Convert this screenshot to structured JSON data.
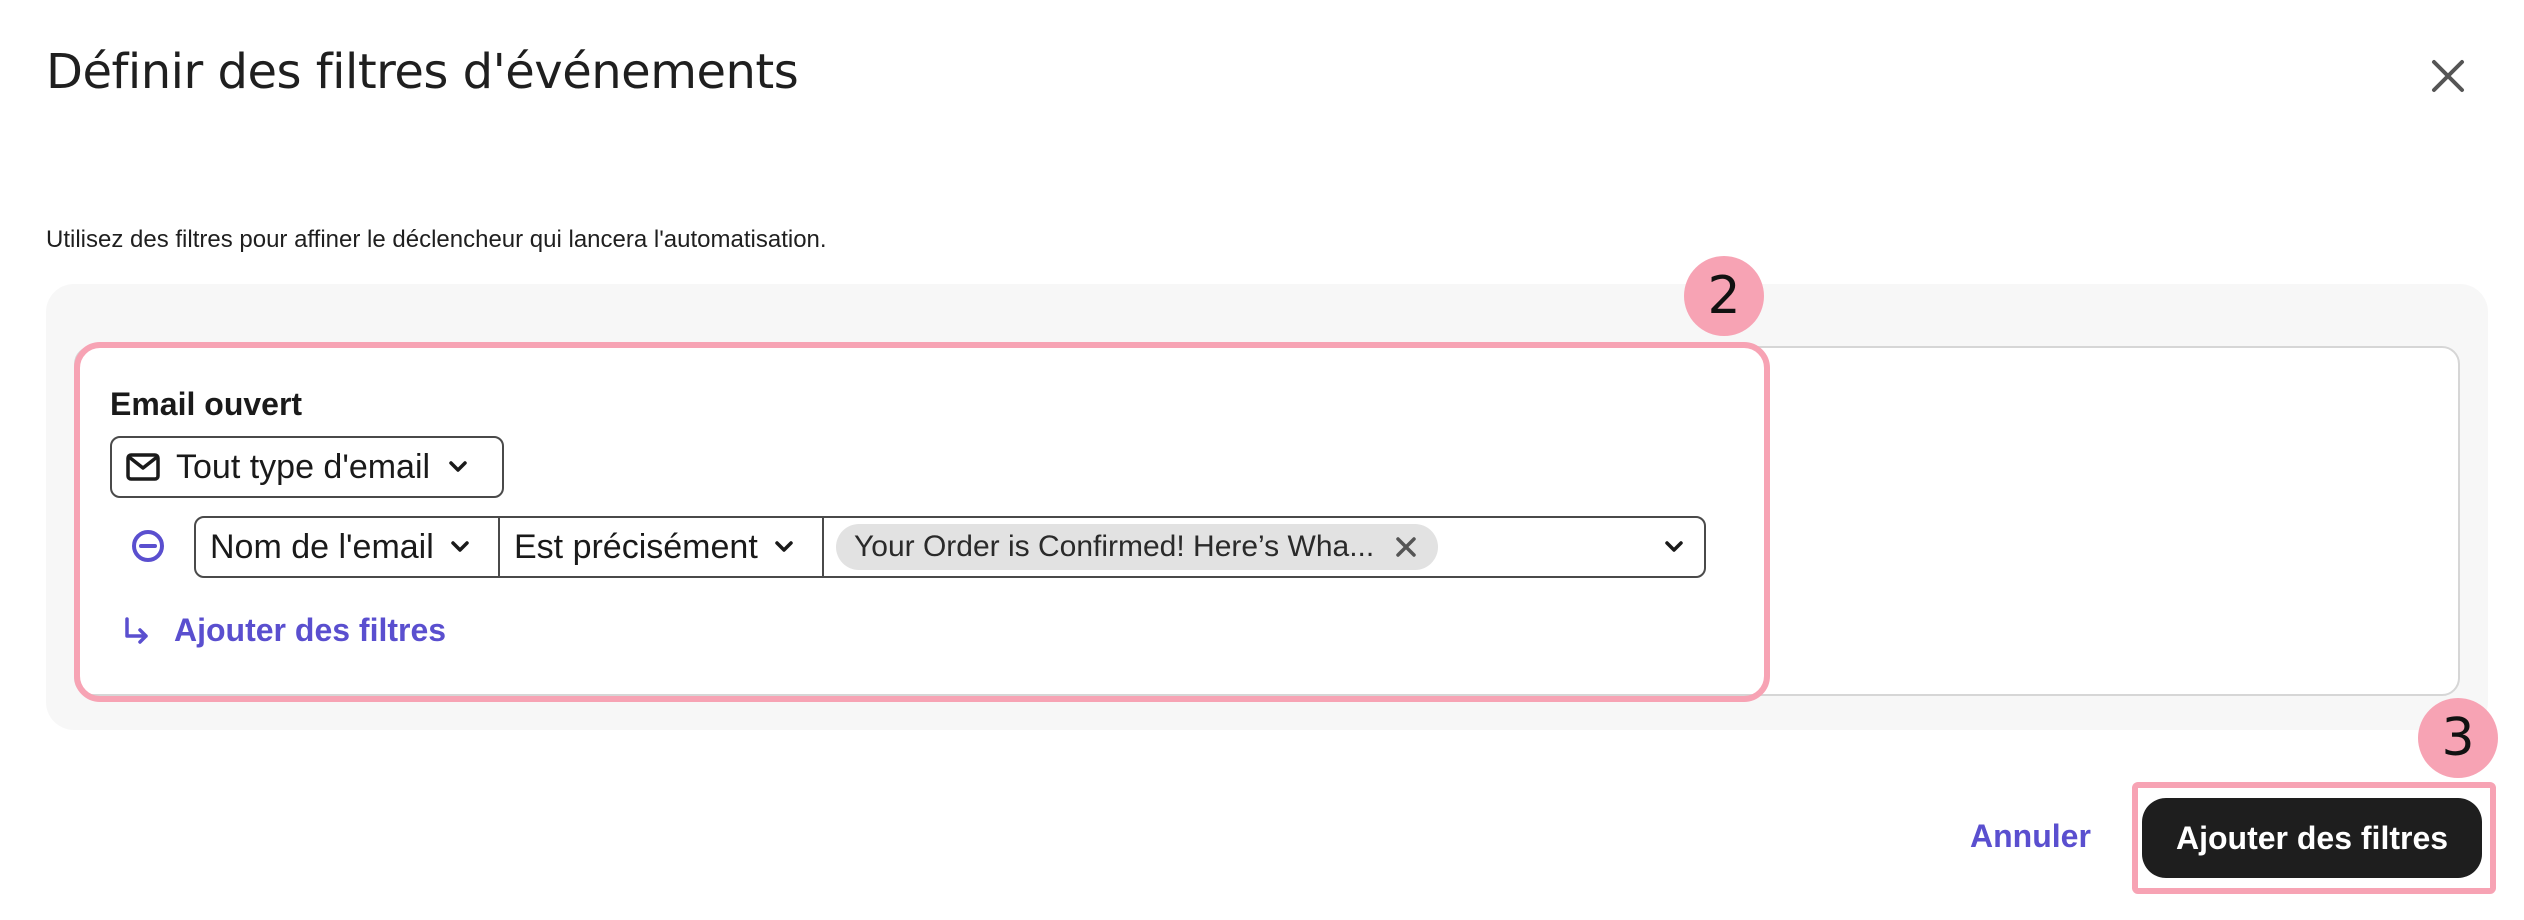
{
  "dialog": {
    "title": "Définir des filtres d'événements",
    "description": "Utilisez des filtres pour affiner le déclencheur qui lancera l'automatisation."
  },
  "filter_card": {
    "event_title": "Email ouvert",
    "email_type_select": {
      "value": "Tout type d'email",
      "icon": "envelope-icon"
    },
    "filter_row": {
      "field": "Nom de l'email",
      "operator": "Est précisément",
      "value_tag": "Your Order is Confirmed! Here’s Wha..."
    },
    "add_filters_label": "Ajouter des filtres"
  },
  "footer": {
    "cancel_label": "Annuler",
    "submit_label": "Ajouter des filtres"
  },
  "annotations": {
    "badge_2": "2",
    "badge_3": "3"
  },
  "colors": {
    "accent": "#5a4fcf",
    "highlight": "#f7a3b4",
    "primary_button": "#1e1e1e",
    "panel_bg": "#f7f7f7"
  }
}
